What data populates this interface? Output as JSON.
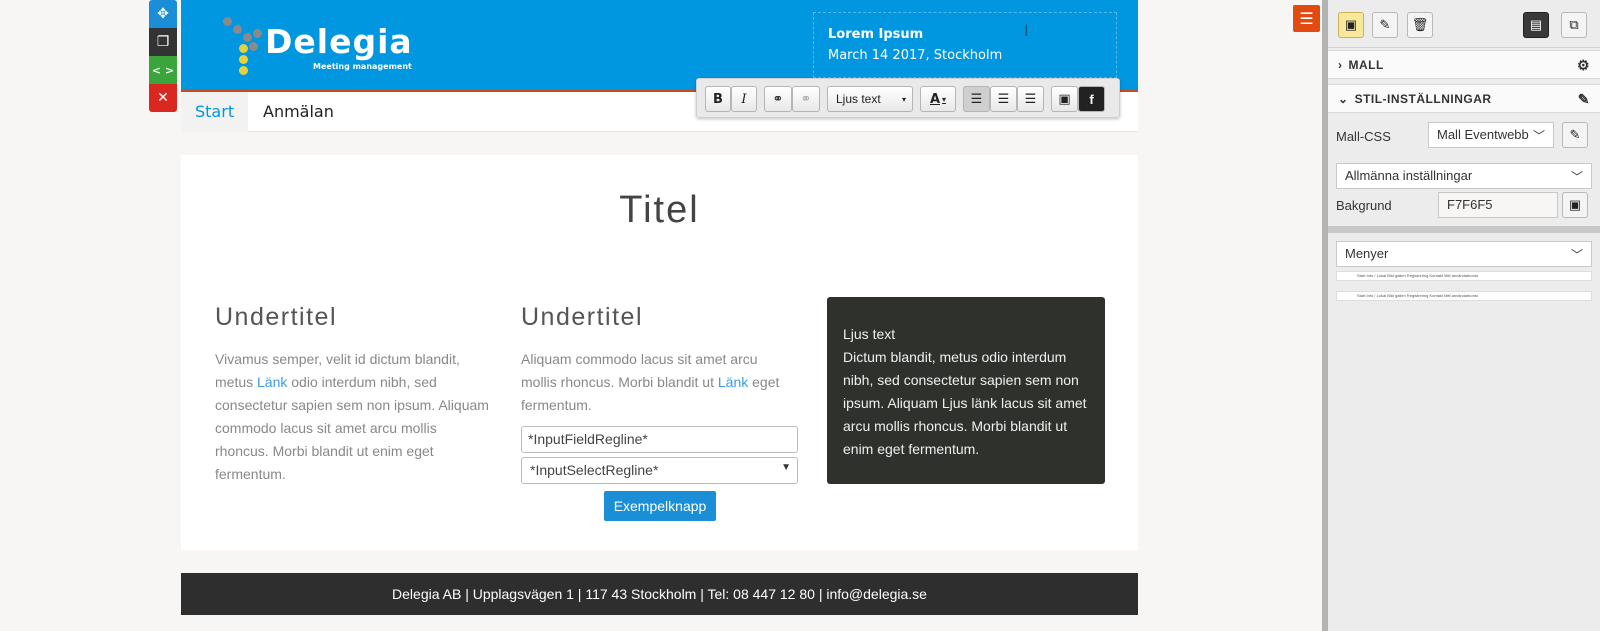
{
  "tools": {
    "move": "✥",
    "copy": "❐",
    "code": "< >",
    "delete": "✕"
  },
  "header": {
    "logo_text": "Delegia",
    "logo_subtitle": "Meeting management",
    "title": "Lorem Ipsum",
    "subtitle": "March 14 2017, Stockholm"
  },
  "nav": {
    "items": [
      {
        "label": "Start",
        "active": true
      },
      {
        "label": "Anmälan",
        "active": false
      }
    ]
  },
  "toolbar": {
    "bold": "B",
    "italic": "I",
    "link": "⚭",
    "unlink": "⚭",
    "style_select": "Ljus text",
    "font_color": "A",
    "align_left": "☰",
    "align_center": "☰",
    "align_right": "☰",
    "image": "▣",
    "facebook": "f"
  },
  "main": {
    "title": "Titel",
    "col1": {
      "heading": "Undertitel",
      "text_before": "Vivamus semper, velit id dictum blandit, metus ",
      "link": "Länk",
      "text_after": " odio interdum nibh, sed consectetur sapien sem non ipsum. Aliquam commodo lacus sit amet arcu mollis rhoncus. Morbi blandit ut enim eget fermentum."
    },
    "col2": {
      "heading": "Undertitel",
      "text_before": "Aliquam commodo lacus sit amet arcu mollis rhoncus. Morbi blandit ut ",
      "link": "Länk",
      "text_after": " eget fermentum.",
      "input_value": "*InputFieldRegline*",
      "select_value": "*InputSelectRegline*",
      "button_label": "Exempelknapp"
    },
    "darkbox": {
      "line1": "Ljus text",
      "body": "Dictum blandit, metus odio interdum nibh, sed consectetur sapien sem non ipsum. Aliquam Ljus länk lacus sit amet arcu mollis rhoncus. Morbi blandit ut enim eget fermentum."
    }
  },
  "footer": {
    "text": "Delegia AB | Upplagsvägen 1 | 117 43 Stockholm | Tel: 08 447 12 80 | info@delegia.se"
  },
  "panel": {
    "sections": {
      "mall": "MALL",
      "stil": "STIL-INSTÄLLNINGAR"
    },
    "mall_css_label": "Mall-CSS",
    "mall_css_value": "Mall Eventwebb 1",
    "general_settings": "Allmänna inställningar",
    "background_label": "Bakgrund",
    "background_value": "F7F6F5",
    "menus_label": "Menyer",
    "mini_menu_1": "Start    Info / Lokal    Bild galleri    Registrering    Kontakt    Mitt användarkonto",
    "mini_menu_2": "Start    Info / Lokal    Bild galleri    Registrering    Kontakt    Mitt användarkonto"
  },
  "colors": {
    "header_blue": "#0096e0",
    "accent_orange": "#e34a11",
    "dark_box": "#2e312c",
    "footer": "#2e2e2e",
    "page_bg": "#f7f6f5"
  }
}
